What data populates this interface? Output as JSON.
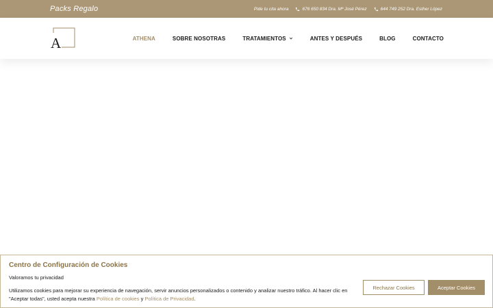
{
  "topbar": {
    "promo": "Packs Regalo",
    "appointment_label": "Pide tu cita ahora",
    "contacts": [
      {
        "text": "676 650 834 Dra. Mª José Pérez",
        "icon": "phone-icon"
      },
      {
        "text": "644 749 252 Dra. Esther López",
        "icon": "phone-icon"
      }
    ],
    "colors": {
      "background": "#ab9776",
      "text": "#ffffff"
    }
  },
  "header": {
    "logo_letter": "A",
    "nav": [
      {
        "label": "ATHENA",
        "active": true
      },
      {
        "label": "SOBRE NOSOTRAS",
        "active": false
      },
      {
        "label": "TRATAMIENTOS",
        "active": false,
        "dropdown": true
      },
      {
        "label": "ANTES Y DESPUÉS",
        "active": false
      },
      {
        "label": "BLOG",
        "active": false
      },
      {
        "label": "CONTACTO",
        "active": false
      }
    ],
    "colors": {
      "active": "#a38e6a",
      "text": "#1a1a1a"
    }
  },
  "cookies": {
    "title": "Centro de Configuración de Cookies",
    "subtitle": "Valoramos tu privacidad",
    "body_part1": "Utilizamos cookies para mejorar su experiencia de navegación, servir anuncios personalizados o contenido y analizar nuestro tráfico. Al hacer clic en \"Aceptar todas\", usted acepta nuestra",
    "link_cookies": "Política de cookies",
    "conjunction": "y",
    "link_privacy": "Política de Privacidad",
    "period": ".",
    "reject_label": "Rechazar Cookies",
    "accept_label": "Aceptar Cookies",
    "colors": {
      "accent": "#a38e6a",
      "title": "#8a7448",
      "border": "#c7b697"
    }
  }
}
